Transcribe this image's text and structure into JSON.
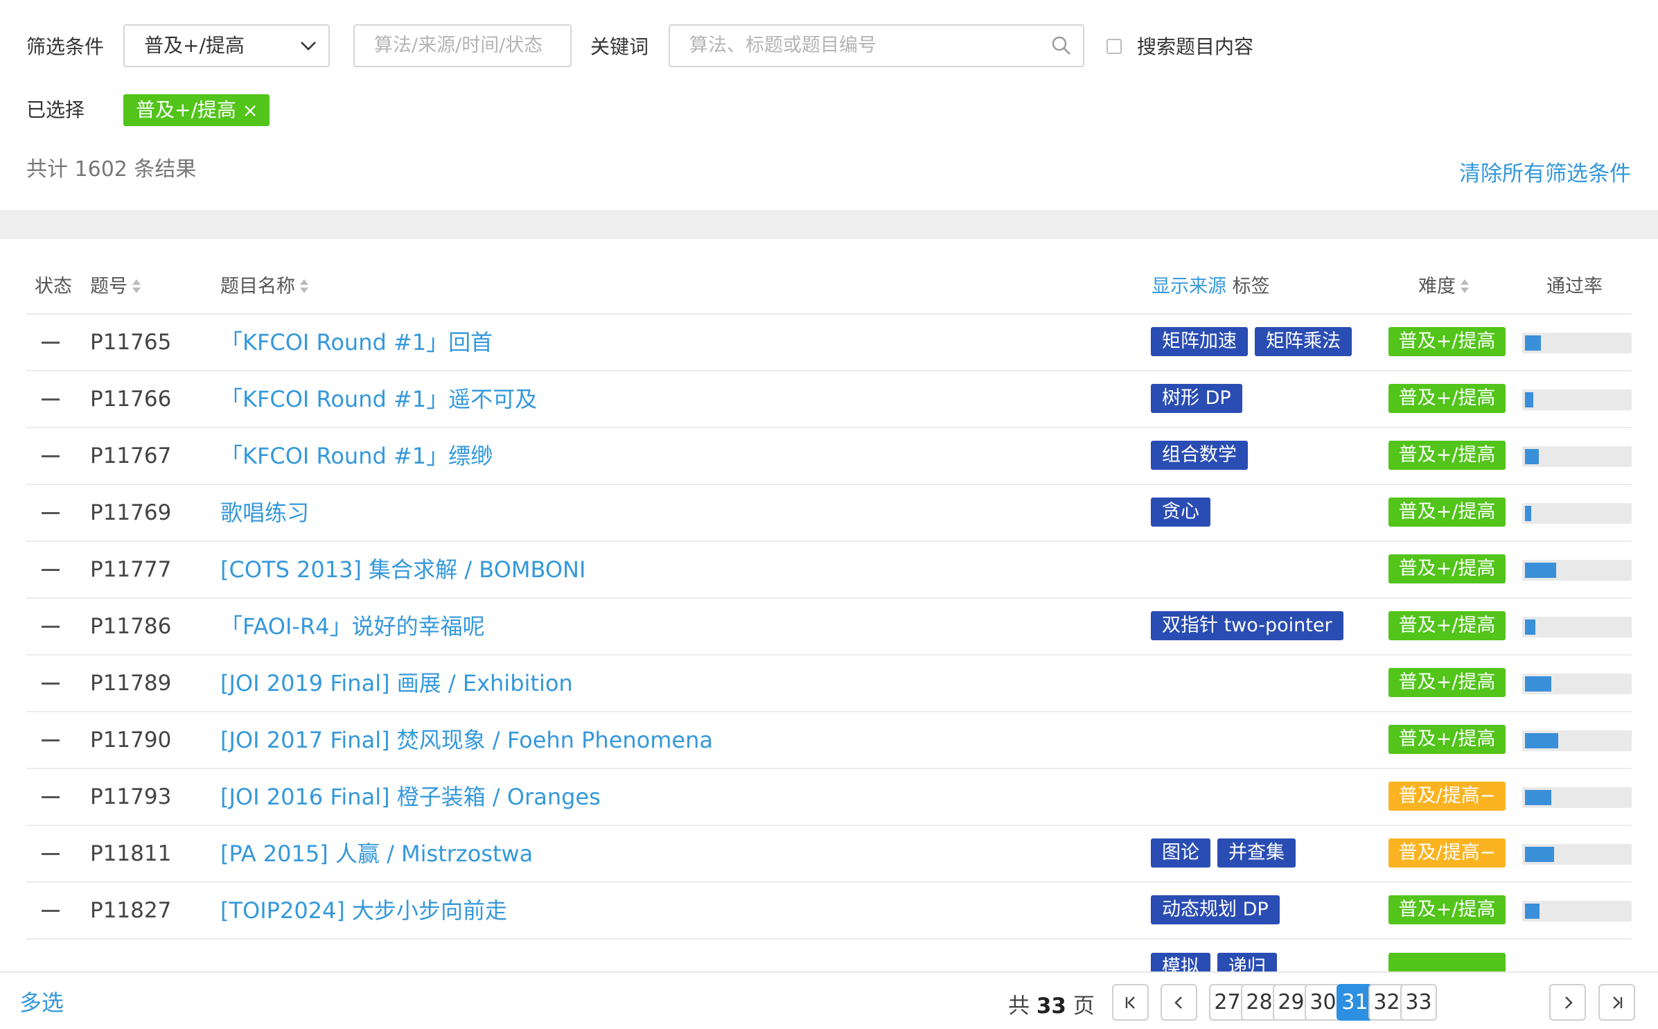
{
  "filter": {
    "label": "筛选条件",
    "difficulty_select": "普及+/提高",
    "algo_placeholder": "算法/来源/时间/状态",
    "keyword_label": "关键词",
    "keyword_placeholder": "算法、标题或题目编号",
    "search_content_label": "搜索题目内容",
    "selected_label": "已选择",
    "selected_chip": "普及+/提高",
    "count_text": "共计 1602 条结果",
    "clear_all": "清除所有筛选条件"
  },
  "table": {
    "headers": {
      "status": "状态",
      "pid": "题号",
      "title": "题目名称",
      "show_source": "显示来源",
      "tags": "标签",
      "difficulty": "难度",
      "pass_rate": "通过率"
    },
    "rows": [
      {
        "pid": "P11765",
        "title": "「KFCOI Round #1」回首",
        "tags": [
          "矩阵加速",
          "矩阵乘法"
        ],
        "difficulty": "普及+/提高",
        "diff_color": "#52c41a",
        "rate": 0.15
      },
      {
        "pid": "P11766",
        "title": "「KFCOI Round #1」遥不可及",
        "tags": [
          "树形 DP"
        ],
        "difficulty": "普及+/提高",
        "diff_color": "#52c41a",
        "rate": 0.08
      },
      {
        "pid": "P11767",
        "title": "「KFCOI Round #1」缥缈",
        "tags": [
          "组合数学"
        ],
        "difficulty": "普及+/提高",
        "diff_color": "#52c41a",
        "rate": 0.13
      },
      {
        "pid": "P11769",
        "title": "歌唱练习",
        "tags": [
          "贪心"
        ],
        "difficulty": "普及+/提高",
        "diff_color": "#52c41a",
        "rate": 0.06
      },
      {
        "pid": "P11777",
        "title": "[COTS 2013] 集合求解 / BOMBONI",
        "tags": [],
        "difficulty": "普及+/提高",
        "diff_color": "#52c41a",
        "rate": 0.3
      },
      {
        "pid": "P11786",
        "title": "「FAOI-R4」说好的幸福呢",
        "tags": [
          "双指针 two-pointer"
        ],
        "difficulty": "普及+/提高",
        "diff_color": "#52c41a",
        "rate": 0.1
      },
      {
        "pid": "P11789",
        "title": "[JOI 2019 Final] 画展 / Exhibition",
        "tags": [],
        "difficulty": "普及+/提高",
        "diff_color": "#52c41a",
        "rate": 0.25
      },
      {
        "pid": "P11790",
        "title": "[JOI 2017 Final] 焚风现象 / Foehn Phenomena",
        "tags": [],
        "difficulty": "普及+/提高",
        "diff_color": "#52c41a",
        "rate": 0.32
      },
      {
        "pid": "P11793",
        "title": "[JOI 2016 Final] 橙子装箱 / Oranges",
        "tags": [],
        "difficulty": "普及/提高−",
        "diff_color": "#fbb321",
        "rate": 0.25
      },
      {
        "pid": "P11811",
        "title": "[PA 2015] 人赢 / Mistrzostwa",
        "tags": [
          "图论",
          "并查集"
        ],
        "difficulty": "普及/提高−",
        "diff_color": "#fbb321",
        "rate": 0.28
      },
      {
        "pid": "P11827",
        "title": "[TOIP2024] 大步小步向前走",
        "tags": [
          "动态规划 DP"
        ],
        "difficulty": "普及+/提高",
        "diff_color": "#52c41a",
        "rate": 0.14
      }
    ],
    "partial_tags": [
      "模拟",
      "递归"
    ]
  },
  "footer": {
    "multi_select": "多选",
    "total_prefix": "共",
    "total_pages": "33",
    "total_suffix": "页",
    "pages": [
      "27",
      "28",
      "29",
      "30",
      "31",
      "32",
      "33"
    ],
    "current_page": "31"
  }
}
